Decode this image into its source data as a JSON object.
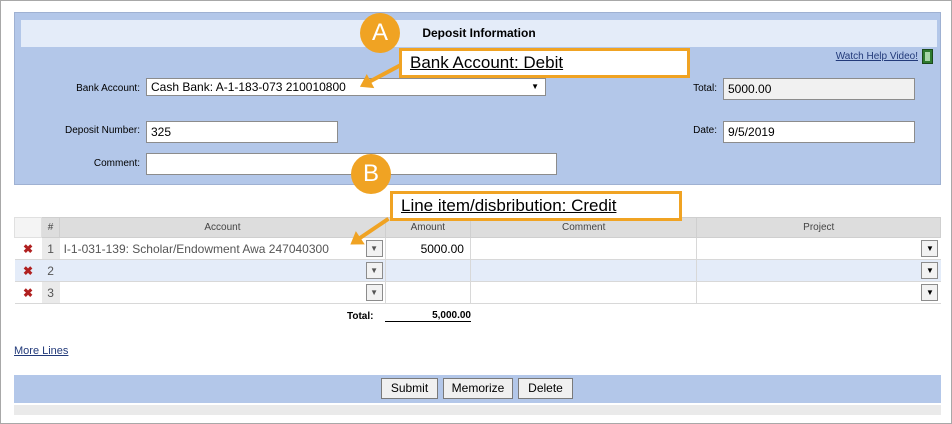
{
  "panel": {
    "title": "Deposit Information",
    "help_link": "Watch Help Video!",
    "bank_account_label": "Bank Account:",
    "bank_account_value": "Cash Bank: A-1-183-073 210010800",
    "total_label": "Total:",
    "total_value": "5000.00",
    "deposit_number_label": "Deposit Number:",
    "deposit_number_value": "325",
    "date_label": "Date:",
    "date_value": "9/5/2019",
    "comment_label": "Comment:",
    "comment_value": ""
  },
  "grid": {
    "headers": {
      "num": "#",
      "account": "Account",
      "amount": "Amount",
      "comment": "Comment",
      "project": "Project"
    },
    "rows": [
      {
        "num": "1",
        "account": "I-1-031-139: Scholar/Endowment Awa 247040300",
        "amount": "5000.00",
        "comment": "",
        "project": ""
      },
      {
        "num": "2",
        "account": "",
        "amount": "",
        "comment": "",
        "project": ""
      },
      {
        "num": "3",
        "account": "",
        "amount": "",
        "comment": "",
        "project": ""
      }
    ],
    "total_label": "Total:",
    "total_value": "5,000.00"
  },
  "more_lines": "More Lines",
  "buttons": {
    "submit": "Submit",
    "memorize": "Memorize",
    "delete": "Delete"
  },
  "annotations": {
    "a_badge": "A",
    "a_text": "Bank Account: Debit",
    "b_badge": "B",
    "b_text": "Line item/disbribution: Credit",
    "color": "#f0a323"
  },
  "icons": {
    "delete_row": "x-icon",
    "help_video": "film-icon",
    "dropdown": "chevron-down-icon"
  }
}
